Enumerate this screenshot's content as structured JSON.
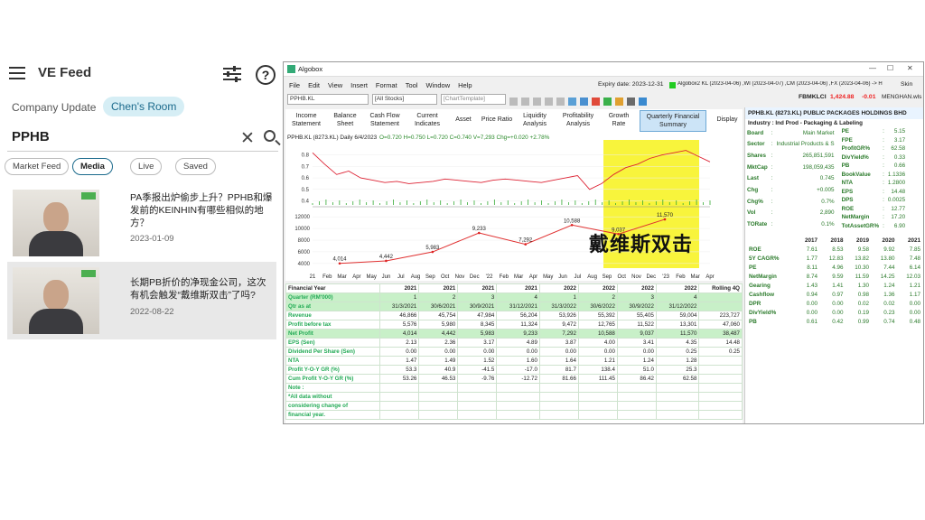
{
  "feed": {
    "title": "VE Feed",
    "help": "?",
    "tabs": [
      "Company Update",
      "Chen's Room"
    ],
    "search_value": "PPHB",
    "chips": [
      "Market Feed",
      "Media",
      "Live",
      "Saved"
    ],
    "items": [
      {
        "title": "PA季报出炉偷步上升？PPHB和爆发前的KEINHIN有哪些相似的地方？",
        "date": "2023-01-09"
      },
      {
        "title": "长期PB折价的净现金公司，这次有机会触发“戴维斯双击”了吗?",
        "date": "2022-08-22"
      }
    ]
  },
  "window": {
    "app_title": "Algobox",
    "menu": [
      "File",
      "Edit",
      "View",
      "Insert",
      "Format",
      "Tool",
      "Window",
      "Help"
    ],
    "expiry": "Expiry date: 2023-12-31",
    "status": "Algobox2 KL (2023-04-06) ,WI (2023-04-07) ,CM (2023-04-06) ,FX (2023-04-06) -> H",
    "skin": "Skin",
    "symbol": "PPHB.KL",
    "stocks": "[All Stocks]",
    "template": "[ChartTemplate]",
    "index_label": "FBMKLCI",
    "index_value": "1,424.88",
    "index_change": "-0.01",
    "user": "MENGHAN.wls",
    "tabs": [
      "Income Statement",
      "Balance Sheet",
      "Cash Flow Statement",
      "Current Indicates",
      "Asset",
      "Price Ratio",
      "Liquidity Analysis",
      "Profitability Analysis",
      "Growth Rate",
      "Quarterly Financial Summary",
      "Display"
    ]
  },
  "chart_data": [
    {
      "type": "line",
      "title": "PPHB.KL (8273.KL) Daily 6/4/2023",
      "ohlc_text": "O=0.720  H=0.750  L=0.720  C=0.740  V=7,293  Chg=+0.020  +2.78%",
      "x": [
        "21",
        "Feb",
        "Mar",
        "Apr",
        "May",
        "Jun",
        "Jul",
        "Aug",
        "Sep",
        "Oct",
        "Nov",
        "Dec",
        "'22",
        "Feb",
        "Mar",
        "Apr",
        "May",
        "Jun",
        "Jul",
        "Aug",
        "Sep",
        "Oct",
        "Nov",
        "Dec",
        "'23",
        "Feb",
        "Mar",
        "Apr"
      ],
      "yticks": [
        0.4,
        0.5,
        0.6,
        0.7,
        0.8
      ],
      "ylim": [
        0.38,
        0.9
      ],
      "series": [
        {
          "values": [
            0.82,
            0.72,
            0.63,
            0.66,
            0.6,
            0.58,
            0.56,
            0.57,
            0.55,
            0.56,
            0.57,
            0.59,
            0.58,
            0.57,
            0.56,
            0.58,
            0.59,
            0.58,
            0.57,
            0.56,
            0.58,
            0.6,
            0.62,
            0.5,
            0.55,
            0.63,
            0.69,
            0.72,
            0.77,
            0.8,
            0.82,
            0.84,
            0.79,
            0.74
          ]
        }
      ]
    },
    {
      "type": "line",
      "title": "",
      "x": [
        "2021Q1",
        "2021Q2",
        "2021Q3",
        "2021Q4",
        "2022Q1",
        "2022Q2",
        "2022Q3",
        "2022Q4"
      ],
      "yticks": [
        4000,
        6000,
        8000,
        10000,
        12000
      ],
      "ylim": [
        3200,
        12800
      ],
      "values": [
        4014,
        4442,
        5983,
        9233,
        7292,
        10588,
        9037,
        11570
      ],
      "labels": [
        "4,014",
        "4,442",
        "5,983",
        "9,233",
        "7,292",
        "10,588",
        "9,037",
        "11,570"
      ],
      "highlight": "戴维斯双击"
    }
  ],
  "fin_table": {
    "headers": [
      "Financial Year",
      "2021",
      "2021",
      "2021",
      "2021",
      "2022",
      "2022",
      "2022",
      "2022",
      "Rolling 4Q"
    ],
    "rows": [
      [
        "Quarter (RM'000)",
        "1",
        "2",
        "3",
        "4",
        "1",
        "2",
        "3",
        "4",
        ""
      ],
      [
        "Qtr as at",
        "31/3/2021",
        "30/6/2021",
        "30/9/2021",
        "31/12/2021",
        "31/3/2022",
        "30/6/2022",
        "30/9/2022",
        "31/12/2022",
        ""
      ],
      [
        "Revenue",
        "46,866",
        "45,754",
        "47,984",
        "56,204",
        "53,926",
        "55,392",
        "55,405",
        "59,004",
        "223,727"
      ],
      [
        "Profit before tax",
        "5,576",
        "5,980",
        "8,345",
        "11,324",
        "9,472",
        "12,765",
        "11,522",
        "13,301",
        "47,060"
      ],
      [
        "Net Profit",
        "4,014",
        "4,442",
        "5,983",
        "9,233",
        "7,292",
        "10,588",
        "9,037",
        "11,570",
        "38,487"
      ],
      [
        "EPS (Sen)",
        "2.13",
        "2.36",
        "3.17",
        "4.89",
        "3.87",
        "4.00",
        "3.41",
        "4.35",
        "14.48"
      ],
      [
        "Dividend Per Share (Sen)",
        "0.00",
        "0.00",
        "0.00",
        "0.00",
        "0.00",
        "0.00",
        "0.00",
        "0.25",
        "0.25"
      ],
      [
        "NTA",
        "1.47",
        "1.49",
        "1.52",
        "1.60",
        "1.64",
        "1.21",
        "1.24",
        "1.28",
        ""
      ],
      [
        "Profit Y-O-Y GR (%)",
        "53.3",
        "40.9",
        "-41.5",
        "-17.0",
        "81.7",
        "138.4",
        "51.0",
        "25.3",
        ""
      ],
      [
        "Cum Profit Y-O-Y GR (%)",
        "53.26",
        "46.53",
        "-9.76",
        "-12.72",
        "81.66",
        "111.45",
        "86.42",
        "62.58",
        ""
      ],
      [
        "Note :",
        "",
        "",
        "",
        "",
        "",
        "",
        "",
        "",
        ""
      ],
      [
        "*All data without",
        "",
        "",
        "",
        "",
        "",
        "",
        "",
        "",
        ""
      ],
      [
        "considering change of",
        "",
        "",
        "",
        "",
        "",
        "",
        "",
        "",
        ""
      ],
      [
        "financial year.",
        "",
        "",
        "",
        "",
        "",
        "",
        "",
        "",
        ""
      ]
    ]
  },
  "info": {
    "header": "PPHB.KL (8273.KL) PUBLIC PACKAGES HOLDINGS BHD",
    "industry": "Industry : Ind Prod - Packaging & Labeling",
    "left": [
      [
        "Board",
        ":",
        "Main Market"
      ],
      [
        "Sector",
        ":",
        "Industrial Products & S"
      ],
      [
        "Shares",
        ":",
        "265,851,591"
      ],
      [
        "MktCap",
        ":",
        "198,059,435"
      ],
      [
        "Last",
        ":",
        "0.745"
      ],
      [
        "Chg",
        ":",
        "+0.005"
      ],
      [
        "Chg%",
        ":",
        "0.7%"
      ],
      [
        "Vol",
        ":",
        "2,890"
      ],
      [
        "TORate",
        ":",
        "0.1%"
      ]
    ],
    "right": [
      [
        "PE",
        ":",
        "5.15"
      ],
      [
        "FPE",
        ":",
        "3.17"
      ],
      [
        "ProfitGR%",
        ":",
        "62.58"
      ],
      [
        "DivYield%",
        ":",
        "0.33"
      ],
      [
        "PB",
        ":",
        "0.66"
      ],
      [
        "BookValue",
        ":",
        "1.1336"
      ],
      [
        "NTA",
        ":",
        "1.2800"
      ],
      [
        "EPS",
        ":",
        "14.48"
      ],
      [
        "DPS",
        ":",
        "0.0025"
      ],
      [
        "ROE",
        ":",
        "12.77"
      ],
      [
        "NetMargin",
        ":",
        "17.20"
      ],
      [
        "TotAssetGR%",
        ":",
        "6.90"
      ]
    ],
    "ratio_headers": [
      "",
      "2017",
      "2018",
      "2019",
      "2020",
      "2021"
    ],
    "ratios": [
      [
        "ROE",
        "7.61",
        "8.53",
        "9.58",
        "9.92",
        "7.85"
      ],
      [
        "5Y CAGR%",
        "1.77",
        "12.83",
        "13.82",
        "13.80",
        "7.48"
      ],
      [
        "PE",
        "8.11",
        "4.96",
        "10.30",
        "7.44",
        "6.14"
      ],
      [
        "NetMargin",
        "8.74",
        "9.59",
        "11.59",
        "14.25",
        "12.03"
      ],
      [
        "Gearing",
        "1.43",
        "1.41",
        "1.30",
        "1.24",
        "1.21"
      ],
      [
        "Cashflow",
        "0.94",
        "0.97",
        "0.98",
        "1.36",
        "1.17"
      ],
      [
        "DPR",
        "0.00",
        "0.00",
        "0.02",
        "0.02",
        "0.00"
      ],
      [
        "DivYield%",
        "0.00",
        "0.00",
        "0.19",
        "0.23",
        "0.00"
      ],
      [
        "PB",
        "0.61",
        "0.42",
        "0.99",
        "0.74",
        "0.48"
      ]
    ]
  },
  "colors": {
    "highlight": "#f7f21a",
    "net_profit_line": "#e03030",
    "accent": "#1b6a8c",
    "row_green": "#c8f0c8"
  }
}
